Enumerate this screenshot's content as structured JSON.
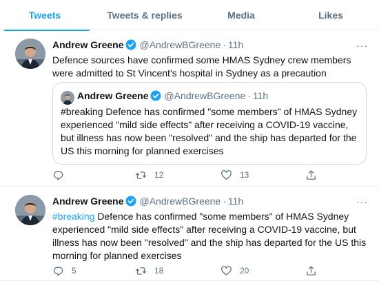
{
  "tabs": [
    {
      "label": "Tweets",
      "active": true
    },
    {
      "label": "Tweets & replies",
      "active": false
    },
    {
      "label": "Media",
      "active": false
    },
    {
      "label": "Likes",
      "active": false
    }
  ],
  "colors": {
    "accent": "#1da1f2",
    "muted": "#5b7083",
    "text": "#0f1419",
    "border": "#e6ecf0"
  },
  "tweets": [
    {
      "name": "Andrew Greene",
      "handle": "@AndrewBGreene",
      "dot": "·",
      "time": "11h",
      "more": "···",
      "text": "Defence sources have confirmed some HMAS Sydney crew members were admitted to St Vincent's hospital in Sydney as a precaution",
      "quote": {
        "name": "Andrew Greene",
        "handle": "@AndrewBGreene",
        "dot": "·",
        "time": "11h",
        "text": "#breaking Defence has confirmed \"some members\" of HMAS Sydney experienced \"mild side effects\" after receiving a COVID-19 vaccine, but illness has now been \"resolved\" and the ship has departed for the US this morning for planned exercises"
      },
      "replies": "",
      "retweets": "12",
      "likes": "13"
    },
    {
      "name": "Andrew Greene",
      "handle": "@AndrewBGreene",
      "dot": "·",
      "time": "11h",
      "more": "···",
      "hashtag": "#breaking",
      "text": " Defence has confirmed \"some members\" of HMAS Sydney experienced \"mild side effects\" after receiving a COVID-19 vaccine, but illness has now been \"resolved\" and the ship has departed for the US this morning for planned exercises",
      "replies": "5",
      "retweets": "18",
      "likes": "20"
    }
  ],
  "icons": {
    "verified": "verified-badge-icon",
    "reply": "reply-icon",
    "retweet": "retweet-icon",
    "like": "heart-icon",
    "share": "share-icon",
    "more": "more-icon"
  }
}
